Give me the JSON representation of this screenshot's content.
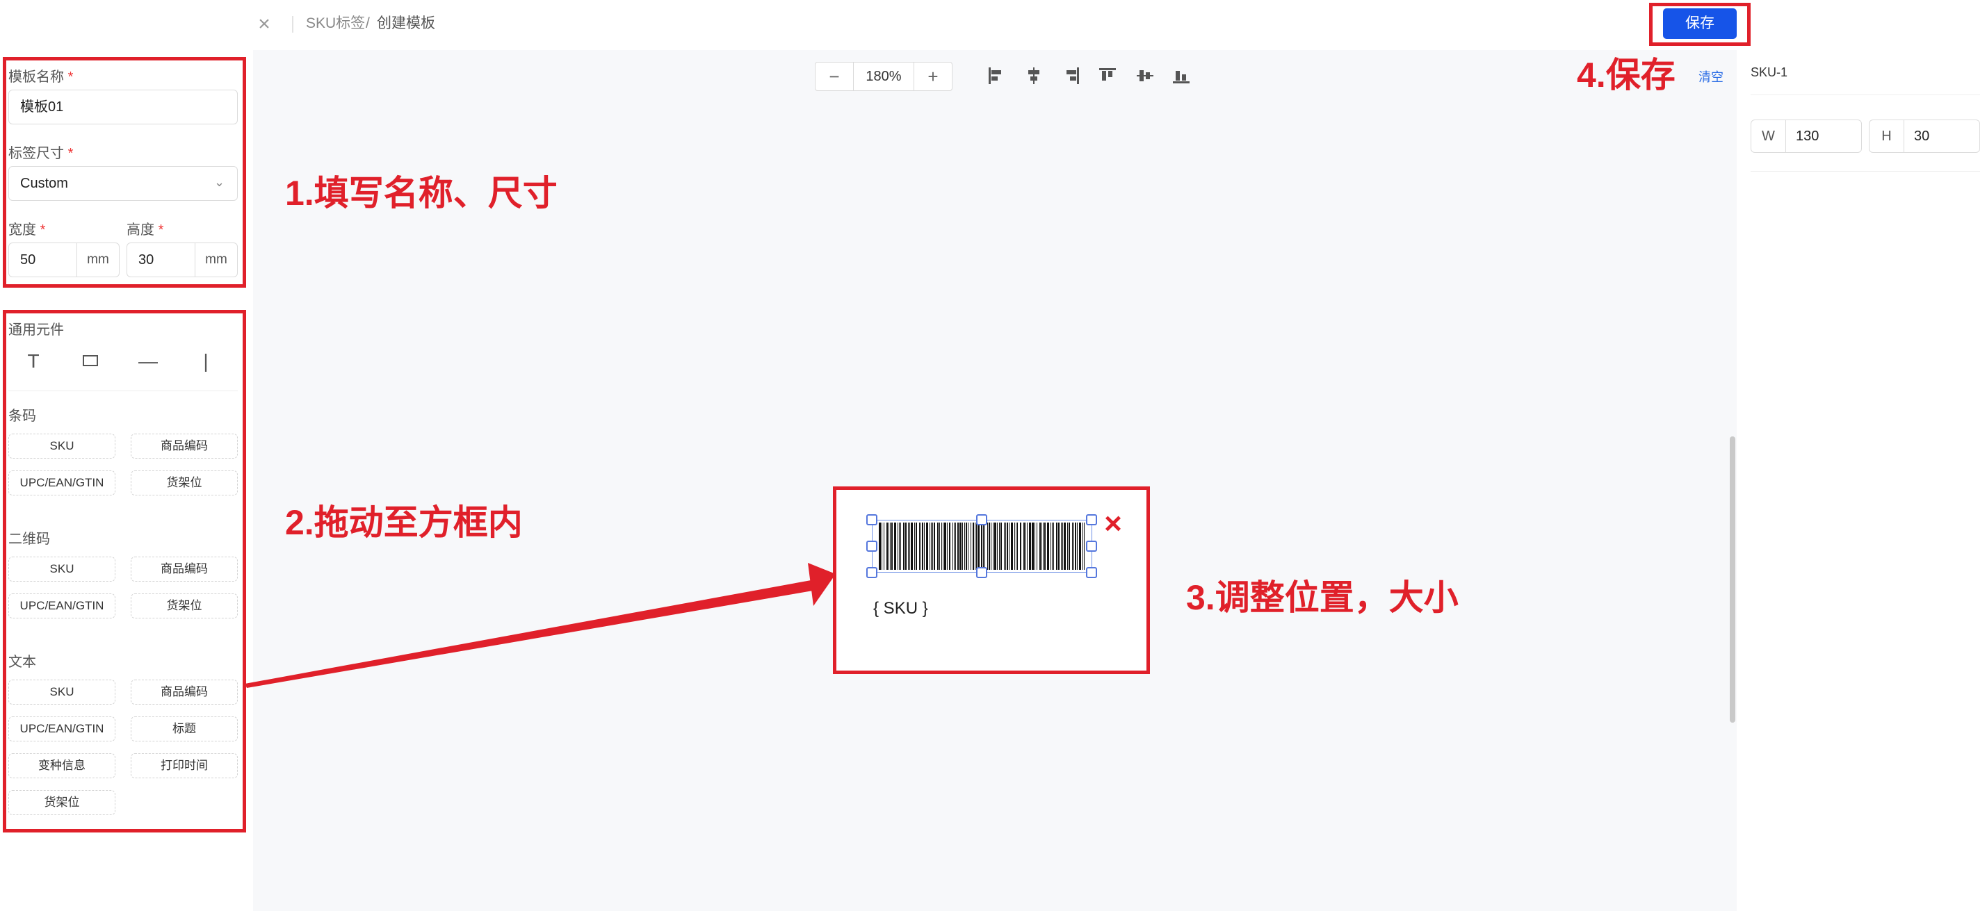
{
  "header": {
    "breadcrumb_parent": "SKU标签",
    "breadcrumb_sep": "/",
    "breadcrumb_current": "创建模板",
    "save_label": "保存"
  },
  "form": {
    "template_name_label": "模板名称",
    "template_name_value": "模板01",
    "size_label": "标签尺寸",
    "size_value": "Custom",
    "width_label": "宽度",
    "width_value": "50",
    "height_label": "高度",
    "height_value": "30",
    "unit": "mm",
    "required_mark": "*"
  },
  "components": {
    "general_title": "通用元件",
    "barcode_title": "条码",
    "barcode_items": [
      "SKU",
      "商品编码",
      "UPC/EAN/GTIN",
      "货架位"
    ],
    "qrcode_title": "二维码",
    "qrcode_items": [
      "SKU",
      "商品编码",
      "UPC/EAN/GTIN",
      "货架位"
    ],
    "text_title": "文本",
    "text_items": [
      "SKU",
      "商品编码",
      "UPC/EAN/GTIN",
      "标题",
      "变种信息",
      "打印时间",
      "货架位"
    ]
  },
  "toolbar": {
    "zoom_value": "180%",
    "zoom_minus": "−",
    "zoom_plus": "+"
  },
  "canvas": {
    "sku_placeholder": "{ SKU }"
  },
  "annotations": {
    "step1": "1.填写名称、尺寸",
    "step2": "2.拖动至方框内",
    "step3": "3.调整位置，大小",
    "step4": "4.保存"
  },
  "right_panel": {
    "clear_label": "清空",
    "object_name": "SKU-1",
    "w_label": "W",
    "w_value": "130",
    "h_label": "H",
    "h_value": "30"
  },
  "colors": {
    "annotation_red": "#e0202a",
    "primary_blue": "#1654e8",
    "selection_blue": "#6c8fe6"
  }
}
